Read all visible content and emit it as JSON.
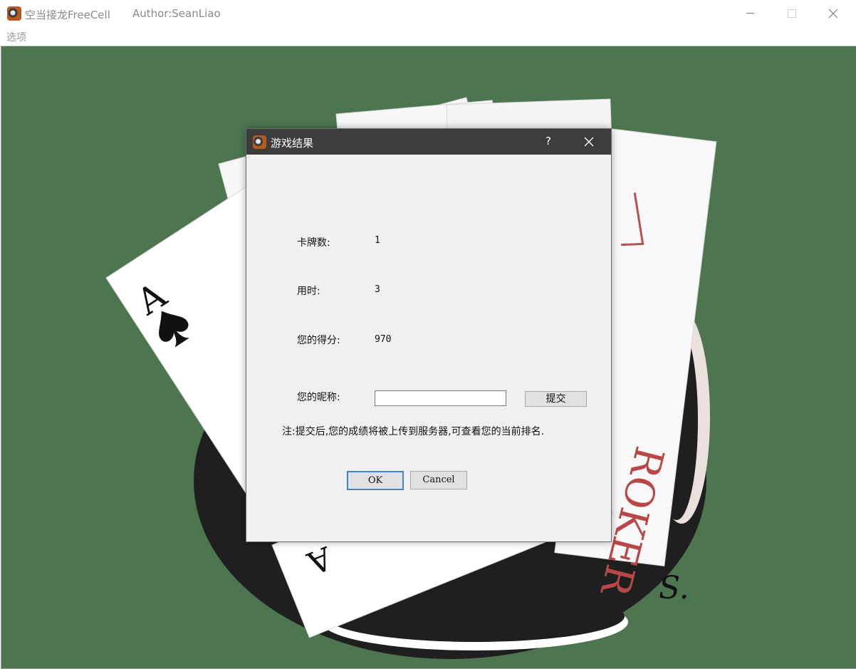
{
  "window": {
    "title": "空当接龙FreeCell",
    "author": "Author:SeanLiao",
    "icons": {
      "app": "app-icon",
      "minimize": "minimize-icon",
      "maximize": "maximize-icon",
      "close": "close-icon"
    }
  },
  "menubar": {
    "items": [
      {
        "label": "选项"
      }
    ]
  },
  "dialog": {
    "title": "游戏结果",
    "help_label": "?",
    "fields": {
      "cards_label": "卡牌数:",
      "cards_value": "1",
      "time_label": "用时:",
      "time_value": "3",
      "score_label": "您的得分:",
      "score_value": "970",
      "nickname_label": "您的昵称:",
      "nickname_value": ""
    },
    "submit_label": "提交",
    "note": "注:提交后,您的成绩将被上传到服务器,可查看您的当前排名.",
    "ok_label": "OK",
    "cancel_label": "Cancel"
  },
  "background": {
    "table_color": "#4c7550",
    "card_corner_text": "A",
    "signature": "S."
  }
}
